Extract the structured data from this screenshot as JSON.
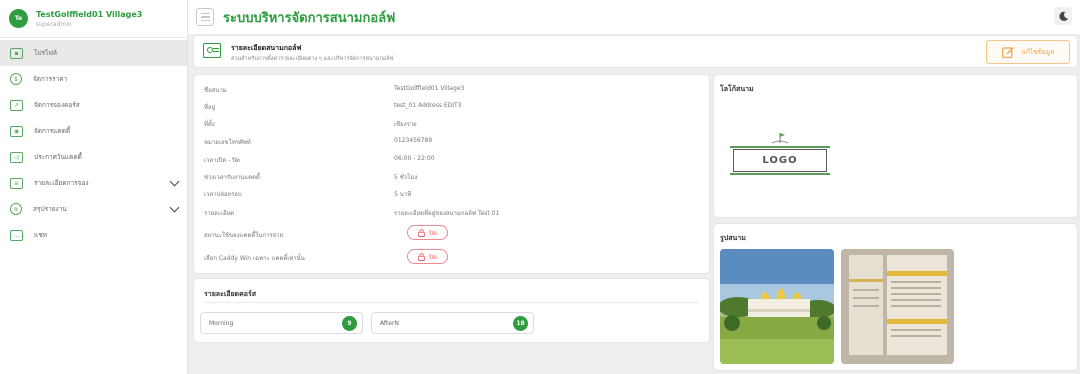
{
  "user": {
    "avatar_initials": "Te",
    "name": "TestGolffield01 Village3",
    "role": "superadmin"
  },
  "sidebar": {
    "items": [
      {
        "label": "โปรไฟล์",
        "icon": "id-card-icon",
        "active": true,
        "expandable": false
      },
      {
        "label": "จัดการราคา",
        "icon": "price-icon",
        "active": false,
        "expandable": false
      },
      {
        "label": "จัดการจองคอร์ส",
        "icon": "chart-icon",
        "active": false,
        "expandable": false
      },
      {
        "label": "จัดการแคดดี้",
        "icon": "caddy-icon",
        "active": false,
        "expandable": false
      },
      {
        "label": "ประกาศวันแคดดี้",
        "icon": "announce-icon",
        "active": false,
        "expandable": false
      },
      {
        "label": "รายละเอียดการจอง",
        "icon": "booking-list-icon",
        "active": false,
        "expandable": true
      },
      {
        "label": "สรุปรายงาน",
        "icon": "report-icon",
        "active": false,
        "expandable": true
      },
      {
        "label": "แชท",
        "icon": "chat-icon",
        "active": false,
        "expandable": false
      }
    ]
  },
  "topbar": {
    "title": "ระบบบริหารจัดการสนามกอล์ฟ"
  },
  "header": {
    "title": "รายละเอียดสนามกอล์ฟ",
    "subtitle": "ส่วนสำหรับการตั้งค่ารายละเอียดต่าง ๆ และบริหารจัดการสนามกอล์ฟ",
    "edit_label": "แก้ไขข้อมูล"
  },
  "details": {
    "rows": [
      {
        "label": "ชื่อสนาม",
        "value": "TestGolffield01 Village3"
      },
      {
        "label": "ที่อยู่",
        "value": "test_01 Address EDIT3"
      },
      {
        "label": "ที่ตั้ง",
        "value": "เชียงราย"
      },
      {
        "label": "หมายเลขโทรศัพท์",
        "value": "0123456789"
      },
      {
        "label": "เวลาเปิด - ปิด",
        "value": "06:00 - 22:00"
      },
      {
        "label": "ช่วงเวลารับงานแคดดี้",
        "value": "5 ชั่วโมง"
      },
      {
        "label": "เวลาปล่อยรอบ",
        "value": "5 นาที"
      },
      {
        "label": "รายละเอียด",
        "value": "รายละเอียดที่อยู่ของสนามกอล์ฟ Test 01"
      }
    ],
    "toggles": [
      {
        "label": "สถานะใช้ของแคดดี้ในการจ่าย",
        "value": "ปิด"
      },
      {
        "label": "เลือก Caddy Win เฉพาะ แคดดี้เท่านั้น",
        "value": "ปิด"
      }
    ]
  },
  "course": {
    "title": "รายละเอียดคอร์ส",
    "items": [
      {
        "name": "Morning",
        "holes": "9"
      },
      {
        "name": "AfterN",
        "holes": "18"
      }
    ]
  },
  "logo_section": {
    "title": "โลโก้สนาม",
    "logo_text": "LOGO"
  },
  "photos_section": {
    "title": "รูปสนาม"
  },
  "colors": {
    "brand_green": "#2e9c3f",
    "edit_orange": "#f0a447",
    "lock_red": "#e66666"
  }
}
